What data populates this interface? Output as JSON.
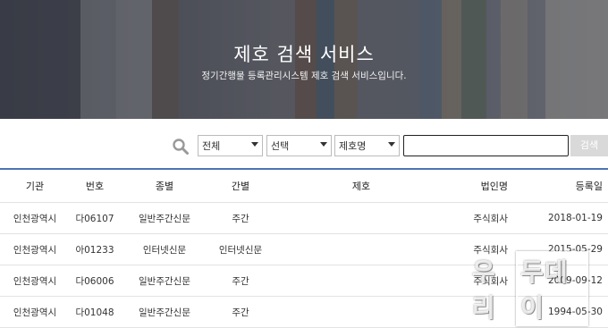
{
  "hero": {
    "title": "제호 검색 서비스",
    "subtitle": "정기간행물 등록관리시스템 제호 검색 서비스입니다."
  },
  "search": {
    "select1": "전체",
    "select2": "선택",
    "select3": "제호명",
    "query": "",
    "button": "검색"
  },
  "table": {
    "headers": {
      "org": "기관",
      "num": "번호",
      "type": "종별",
      "freq": "간별",
      "title": "제호",
      "corp": "법인명",
      "date": "등록일"
    },
    "rows": [
      {
        "org": "인천광역시",
        "num": "다06107",
        "type": "일반주간신문",
        "freq": "주간",
        "title": "",
        "corp": "주식회사",
        "date": "2018-01-19"
      },
      {
        "org": "인천광역시",
        "num": "아01233",
        "type": "인터넷신문",
        "freq": "인터넷신문",
        "title": "",
        "corp": "주식회사",
        "date": "2015-05-29"
      },
      {
        "org": "인천광역시",
        "num": "다06006",
        "type": "일반주간신문",
        "freq": "주간",
        "title": "",
        "corp": "주식회사",
        "date": "2009-09-12"
      },
      {
        "org": "인천광역시",
        "num": "다01048",
        "type": "일반주간신문",
        "freq": "주간",
        "title": "",
        "corp": "",
        "date": "1994-05-30"
      }
    ]
  },
  "watermark": {
    "text": "우리",
    "boxed": "두데이"
  },
  "colors": {
    "accent": "#4d74b3",
    "button": "#d9d9d9"
  }
}
